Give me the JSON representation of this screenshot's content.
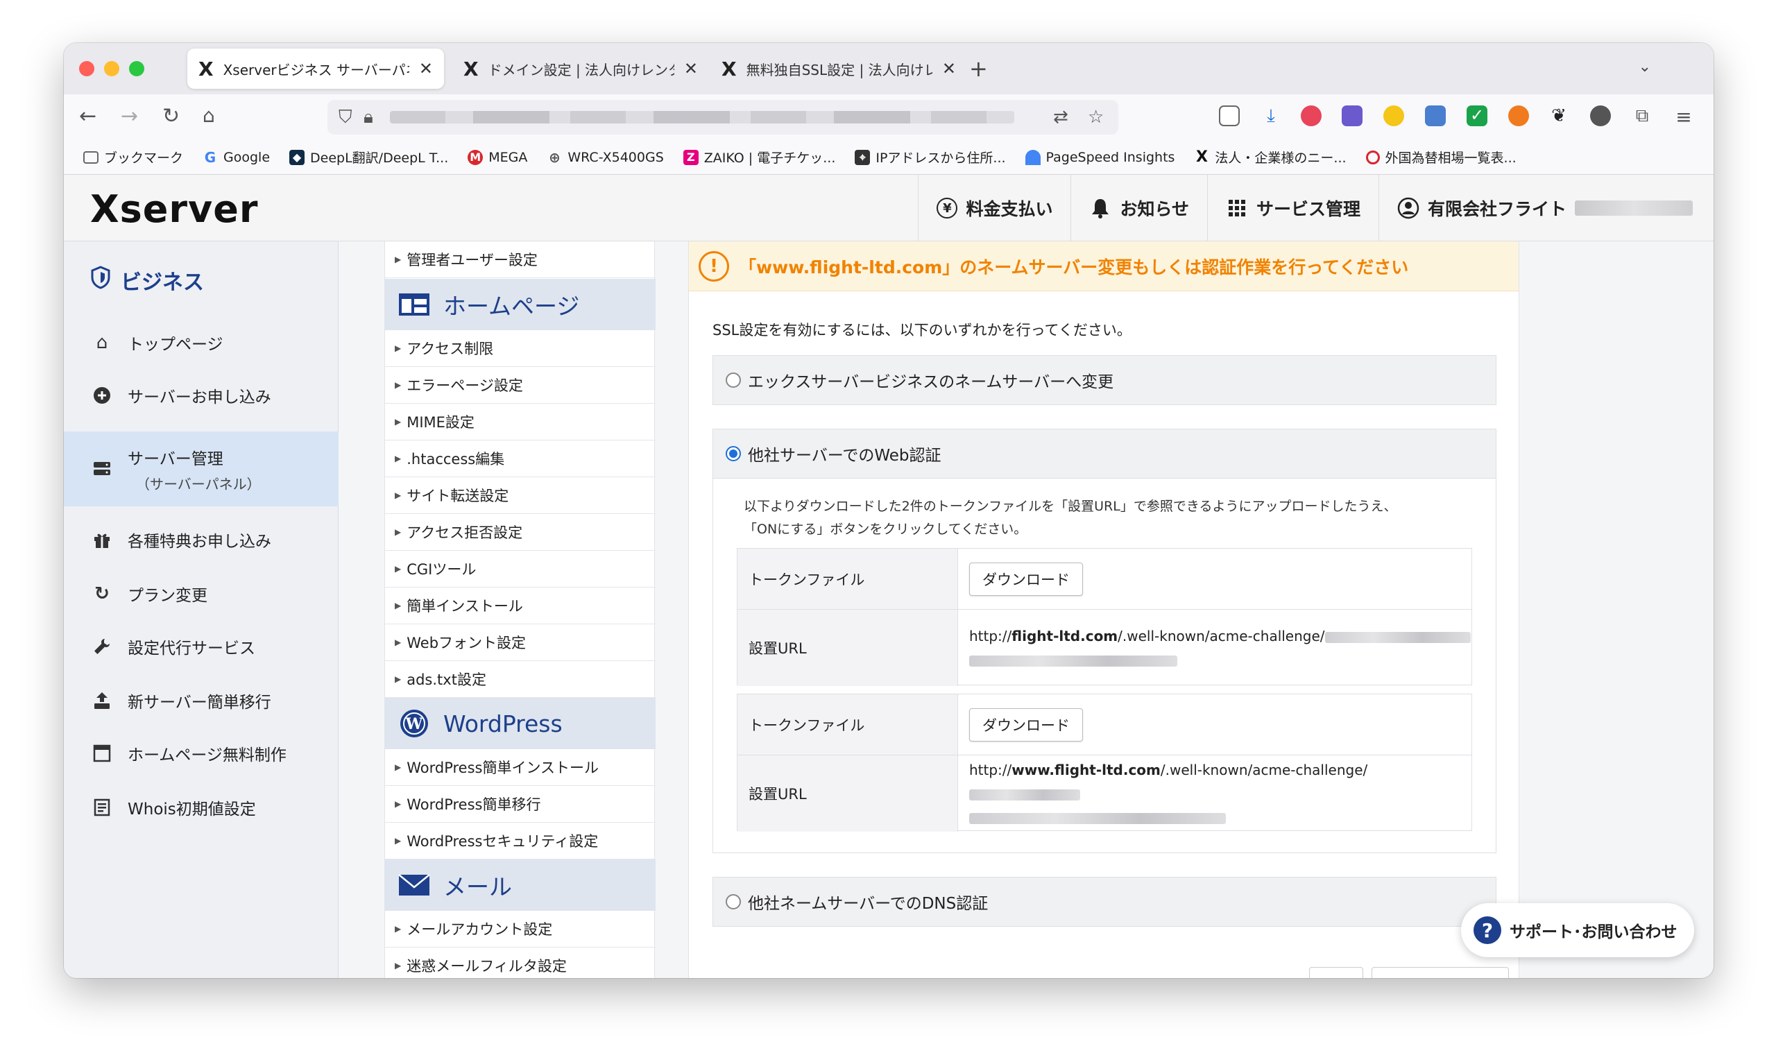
{
  "browser": {
    "tabs": [
      {
        "title": "Xserverビジネス サーバーパネル",
        "active": true
      },
      {
        "title": "ドメイン設定 | 法人向けレンタル",
        "active": false
      },
      {
        "title": "無料独自SSL設定 | 法人向けレン",
        "active": false
      }
    ],
    "new_tab": "+",
    "bookmarks": [
      {
        "label": "ブックマーク",
        "icon": "folder-icon"
      },
      {
        "label": "Google",
        "icon": "google-icon"
      },
      {
        "label": "DeepL翻訳/DeepL T...",
        "icon": "deepl-icon"
      },
      {
        "label": "MEGA",
        "icon": "mega-icon"
      },
      {
        "label": "WRC-X5400GS",
        "icon": "globe-icon"
      },
      {
        "label": "ZAIKO | 電子チケッ...",
        "icon": "zaiko-icon"
      },
      {
        "label": "IPアドレスから住所...",
        "icon": "ip-icon"
      },
      {
        "label": "PageSpeed Insights",
        "icon": "pagespeed-icon"
      },
      {
        "label": "法人・企業様のニー...",
        "icon": "xserver-icon"
      },
      {
        "label": "外国為替相場一覧表...",
        "icon": "mufg-icon"
      }
    ]
  },
  "header": {
    "brand": "Xserver",
    "nav": [
      {
        "label": "料金支払い",
        "icon": "yen-icon"
      },
      {
        "label": "お知らせ",
        "icon": "bell-icon"
      },
      {
        "label": "サービス管理",
        "icon": "grid-icon"
      },
      {
        "label": "有限会社フライト",
        "icon": "user-icon"
      }
    ]
  },
  "sidebar": {
    "title": "ビジネス",
    "items": [
      {
        "label": "トップページ",
        "sub": "",
        "icon": "home-icon"
      },
      {
        "label": "サーバーお申し込み",
        "sub": "",
        "icon": "plus-circle-icon"
      },
      {
        "label": "サーバー管理",
        "sub": "（サーバーパネル）",
        "icon": "server-icon"
      },
      {
        "label": "各種特典お申し込み",
        "sub": "",
        "icon": "gift-icon"
      },
      {
        "label": "プラン変更",
        "sub": "",
        "icon": "refresh-icon"
      },
      {
        "label": "設定代行サービス",
        "sub": "",
        "icon": "wrench-icon"
      },
      {
        "label": "新サーバー簡単移行",
        "sub": "",
        "icon": "upload-icon"
      },
      {
        "label": "ホームページ無料制作",
        "sub": "",
        "icon": "browser-icon"
      },
      {
        "label": "Whois初期値設定",
        "sub": "",
        "icon": "document-icon"
      }
    ]
  },
  "menu": {
    "top_item": "管理者ユーザー設定",
    "sections": [
      {
        "title": "ホームページ",
        "items": [
          "アクセス制限",
          "エラーページ設定",
          "MIME設定",
          ".htaccess編集",
          "サイト転送設定",
          "アクセス拒否設定",
          "CGIツール",
          "簡単インストール",
          "Webフォント設定",
          "ads.txt設定"
        ]
      },
      {
        "title": "WordPress",
        "items": [
          "WordPress簡単インストール",
          "WordPress簡単移行",
          "WordPressセキュリティ設定"
        ]
      },
      {
        "title": "メール",
        "items": [
          "メールアカウント設定",
          "迷惑メールフィルタ設定"
        ]
      }
    ]
  },
  "main": {
    "warning": "「www.flight-ltd.com」のネームサーバー変更もしくは認証作業を行ってください",
    "intro": "SSL設定を有効にするには、以下のいずれかを行ってください。",
    "options": [
      {
        "label": "エックスサーバービジネスのネームサーバーへ変更",
        "selected": false
      },
      {
        "label": "他社サーバーでのWeb認証",
        "selected": true
      },
      {
        "label": "他社ネームサーバーでのDNS認証",
        "selected": false
      }
    ],
    "web_auth": {
      "description_line1": "以下よりダウンロードした2件のトークンファイルを「設置URL」で参照できるようにアップロードしたうえ、",
      "description_line2": "「ONにする」ボタンをクリックしてください。",
      "rows": [
        {
          "token_label": "トークンファイル",
          "download_label": "ダウンロード",
          "url_label": "設置URL",
          "url_prefix": "http://",
          "url_host": "flight-ltd.com",
          "url_path": "/.well-known/acme-challenge/"
        },
        {
          "token_label": "トークンファイル",
          "download_label": "ダウンロード",
          "url_label": "設置URL",
          "url_prefix": "http://",
          "url_host": "www.flight-ltd.com",
          "url_path": "/.well-known/acme-challenge/"
        }
      ]
    }
  },
  "support": {
    "label": "サポート･お問い合わせ",
    "icon": "question-icon"
  },
  "colors": {
    "brand_blue": "#1d3f8c",
    "warning_orange": "#f08300",
    "radio_blue": "#1f6fd8",
    "sidebar_active": "#d7e4f5"
  }
}
